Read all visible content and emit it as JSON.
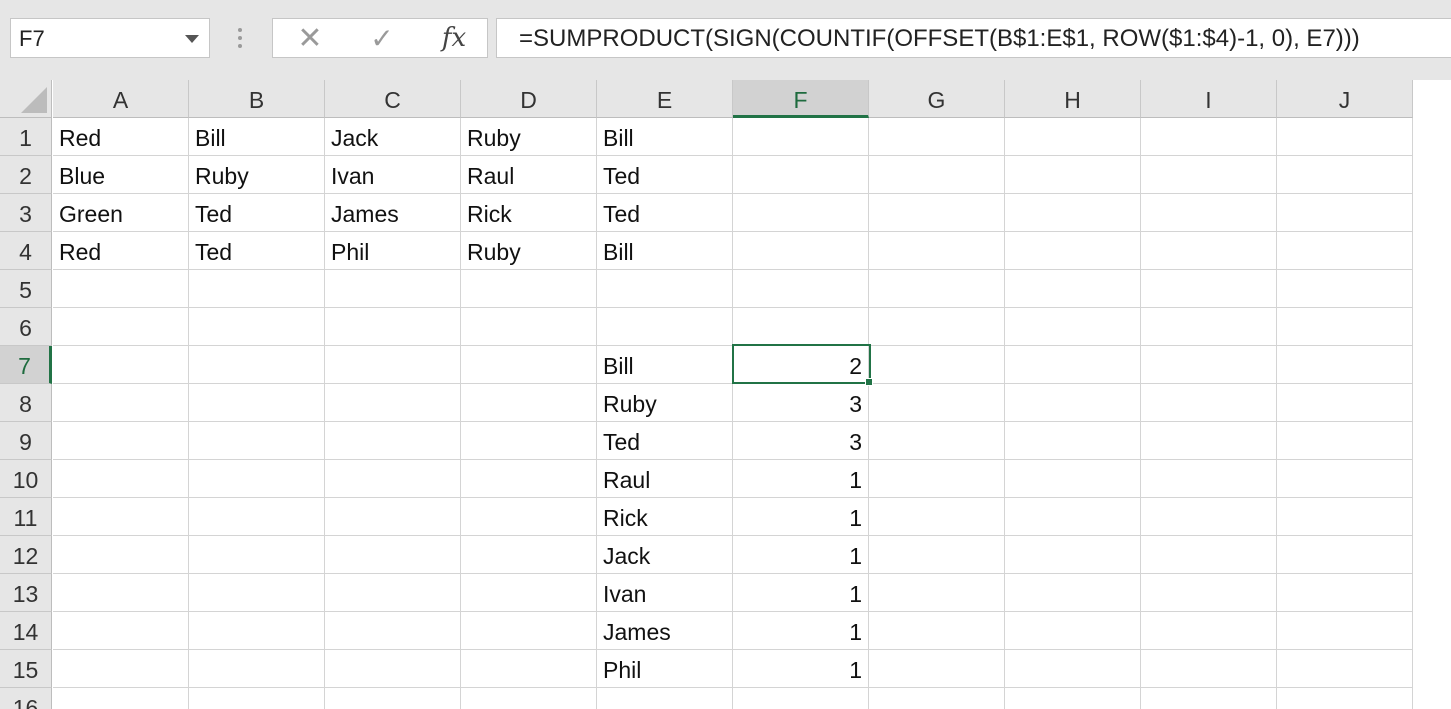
{
  "formula_bar": {
    "name_box": "F7",
    "formula": "=SUMPRODUCT(SIGN(COUNTIF(OFFSET(B$1:E$1, ROW($1:$4)-1, 0), E7)))",
    "fx_label": "fx",
    "cancel_symbol": "✕",
    "enter_symbol": "✓"
  },
  "sheet": {
    "corner_icon": "select-all-triangle-icon",
    "selected_cell": "F7",
    "accent_color": "#217346",
    "columns": [
      "A",
      "B",
      "C",
      "D",
      "E",
      "F",
      "G",
      "H",
      "I",
      "J"
    ],
    "rows": [
      "1",
      "2",
      "3",
      "4",
      "5",
      "6",
      "7",
      "8",
      "9",
      "10",
      "11",
      "12",
      "13",
      "14",
      "15",
      "16"
    ],
    "cells": {
      "A1": "Red",
      "B1": "Bill",
      "C1": "Jack",
      "D1": "Ruby",
      "E1": "Bill",
      "A2": "Blue",
      "B2": "Ruby",
      "C2": "Ivan",
      "D2": "Raul",
      "E2": "Ted",
      "A3": "Green",
      "B3": "Ted",
      "C3": "James",
      "D3": "Rick",
      "E3": "Ted",
      "A4": "Red",
      "B4": "Ted",
      "C4": "Phil",
      "D4": "Ruby",
      "E4": "Bill",
      "E7": "Bill",
      "F7": "2",
      "E8": "Ruby",
      "F8": "3",
      "E9": "Ted",
      "F9": "3",
      "E10": "Raul",
      "F10": "1",
      "E11": "Rick",
      "F11": "1",
      "E12": "Jack",
      "F12": "1",
      "E13": "Ivan",
      "F13": "1",
      "E14": "James",
      "F14": "1",
      "E15": "Phil",
      "F15": "1"
    }
  }
}
